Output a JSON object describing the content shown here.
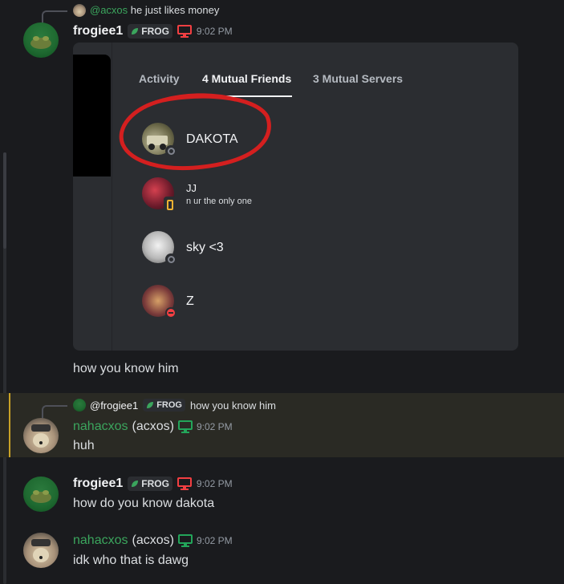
{
  "colors": {
    "accent_red": "#f23f42",
    "online_green": "#23a55a",
    "username_green": "#3ba55d",
    "highlight_bar": "#c9a227"
  },
  "top_reply": {
    "mention": "@acxos",
    "text": "he just likes money"
  },
  "msg1": {
    "username": "frogiee1",
    "tag": "FROG",
    "device_icon": "desktop-icon",
    "time": "9:02 PM"
  },
  "card": {
    "tabs": [
      {
        "label": "Activity"
      },
      {
        "label": "4 Mutual Friends"
      },
      {
        "label": "3 Mutual Servers"
      }
    ],
    "friends": [
      {
        "name": "DAKOTA",
        "subtitle": "",
        "status": "offline"
      },
      {
        "name": "JJ",
        "subtitle": "n ur the only one",
        "status": "mobile"
      },
      {
        "name": "sky <3",
        "subtitle": "",
        "status": "offline"
      },
      {
        "name": "Z",
        "subtitle": "",
        "status": "dnd"
      }
    ]
  },
  "msg1_text": "how you know him",
  "msg2_reply": {
    "username": "@frogiee1",
    "tag": "FROG",
    "text": "how you know him"
  },
  "msg2": {
    "username": "nahacxos",
    "paren": "(acxos)",
    "time": "9:02 PM",
    "text": "huh"
  },
  "msg3": {
    "username": "frogiee1",
    "tag": "FROG",
    "time": "9:02 PM",
    "text": "how do you know dakota"
  },
  "msg4": {
    "username": "nahacxos",
    "paren": "(acxos)",
    "time": "9:02 PM",
    "text": "idk who that is dawg"
  }
}
